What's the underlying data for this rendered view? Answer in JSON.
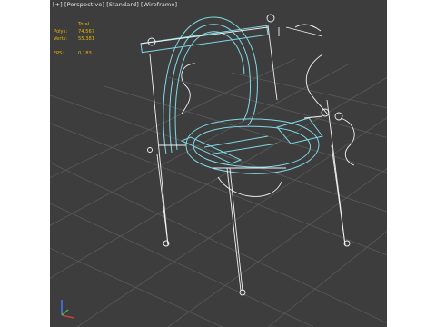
{
  "viewport": {
    "label": {
      "plus": "[+]",
      "view": "[Perspective]",
      "shading_standard": "[Standard]",
      "shading_mode": "[Wireframe]"
    },
    "stats": {
      "total_header": "Total",
      "polys_label": "Polys:",
      "polys_value": "74.567",
      "verts_label": "Verts:",
      "verts_value": "55.381",
      "fps_label": "FPS:",
      "fps_value": "0,183"
    },
    "background_color": "#3d3d3d",
    "grid_color": "#5a5a5a",
    "selected_wire_color": "#7fd8e6",
    "wire_color": "#f2f2f2",
    "stats_color": "#e6b800",
    "axis_gizmo": {
      "icon": "axis-gizmo-icon"
    }
  }
}
